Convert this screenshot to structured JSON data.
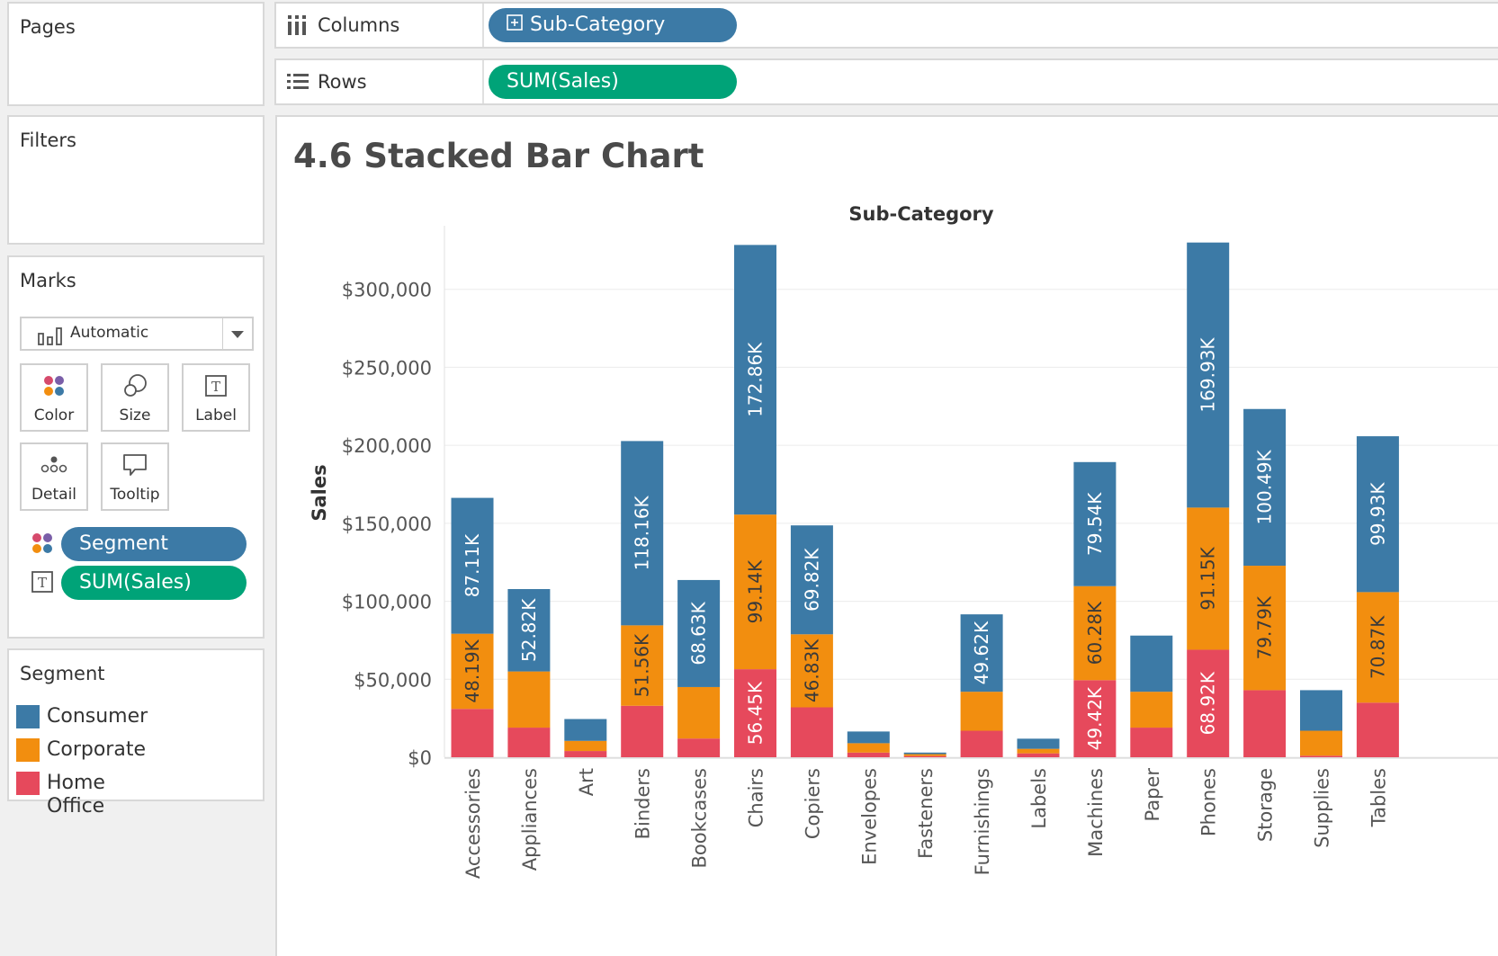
{
  "sidebar": {
    "pages_title": "Pages",
    "filters_title": "Filters",
    "marks": {
      "title": "Marks",
      "type": "Automatic",
      "cards": [
        {
          "label": "Color",
          "icon": "color-icon"
        },
        {
          "label": "Size",
          "icon": "size-icon"
        },
        {
          "label": "Label",
          "icon": "label-icon"
        },
        {
          "label": "Detail",
          "icon": "detail-icon"
        },
        {
          "label": "Tooltip",
          "icon": "tooltip-icon"
        }
      ],
      "pills": [
        {
          "label": "Segment",
          "icon": "color-icon",
          "color": "#3c7aa6"
        },
        {
          "label": "SUM(Sales)",
          "icon": "label-icon",
          "color": "#00a378"
        }
      ]
    },
    "legend": {
      "title": "Segment",
      "items": [
        {
          "label": "Consumer",
          "color": "#3c7aa6"
        },
        {
          "label": "Corporate",
          "color": "#f28e0f"
        },
        {
          "label": "Home Office",
          "color": "#e6495c"
        }
      ]
    }
  },
  "shelves": {
    "columns": {
      "label": "Columns",
      "pill": "Sub-Category",
      "pill_color": "#3c7aa6"
    },
    "rows": {
      "label": "Rows",
      "pill": "SUM(Sales)",
      "pill_color": "#00a378"
    }
  },
  "viz": {
    "title": "4.6 Stacked Bar Chart"
  },
  "chart_data": {
    "type": "bar",
    "stacked": true,
    "xlabel": "Sub-Category",
    "ylabel": "Sales",
    "ylim": [
      0,
      335000
    ],
    "yticks": [
      0,
      50000,
      100000,
      150000,
      200000,
      250000,
      300000
    ],
    "ytick_labels": [
      "$0",
      "$50,000",
      "$100,000",
      "$150,000",
      "$200,000",
      "$250,000",
      "$300,000"
    ],
    "categories": [
      "Accessories",
      "Appliances",
      "Art",
      "Binders",
      "Bookcases",
      "Chairs",
      "Copiers",
      "Envelopes",
      "Fasteners",
      "Furnishings",
      "Labels",
      "Machines",
      "Paper",
      "Phones",
      "Storage",
      "Supplies",
      "Tables"
    ],
    "series": [
      {
        "name": "Home Office",
        "color": "#e6495c",
        "values": [
          31000,
          19000,
          4000,
          33000,
          12000,
          56450,
          32000,
          3000,
          800,
          17000,
          2500,
          49420,
          19000,
          68920,
          43000,
          1000,
          35000
        ],
        "labels": [
          "",
          "",
          "",
          "",
          "",
          "56.45K",
          "",
          "",
          "",
          "",
          "",
          "49.42K",
          "",
          "68.92K",
          "",
          "",
          ""
        ]
      },
      {
        "name": "Corporate",
        "color": "#f28e0f",
        "values": [
          48190,
          36000,
          6500,
          51560,
          33000,
          99140,
          46830,
          6000,
          1200,
          25000,
          2900,
          60280,
          23000,
          91150,
          79790,
          16000,
          70870
        ],
        "labels": [
          "48.19K",
          "",
          "",
          "51.56K",
          "",
          "99.14K",
          "46.83K",
          "",
          "",
          "",
          "",
          "60.28K",
          "",
          "91.15K",
          "79.79K",
          "",
          "70.87K"
        ]
      },
      {
        "name": "Consumer",
        "color": "#3c7aa6",
        "values": [
          87110,
          52820,
          14000,
          118160,
          68630,
          172860,
          69820,
          7500,
          1000,
          49620,
          6500,
          79540,
          36000,
          169930,
          100490,
          26000,
          99930
        ],
        "labels": [
          "87.11K",
          "52.82K",
          "",
          "118.16K",
          "68.63K",
          "172.86K",
          "69.82K",
          "",
          "",
          "49.62K",
          "",
          "79.54K",
          "",
          "169.93K",
          "100.49K",
          "",
          "99.93K"
        ]
      }
    ],
    "legend_position": "left",
    "grid": true
  }
}
